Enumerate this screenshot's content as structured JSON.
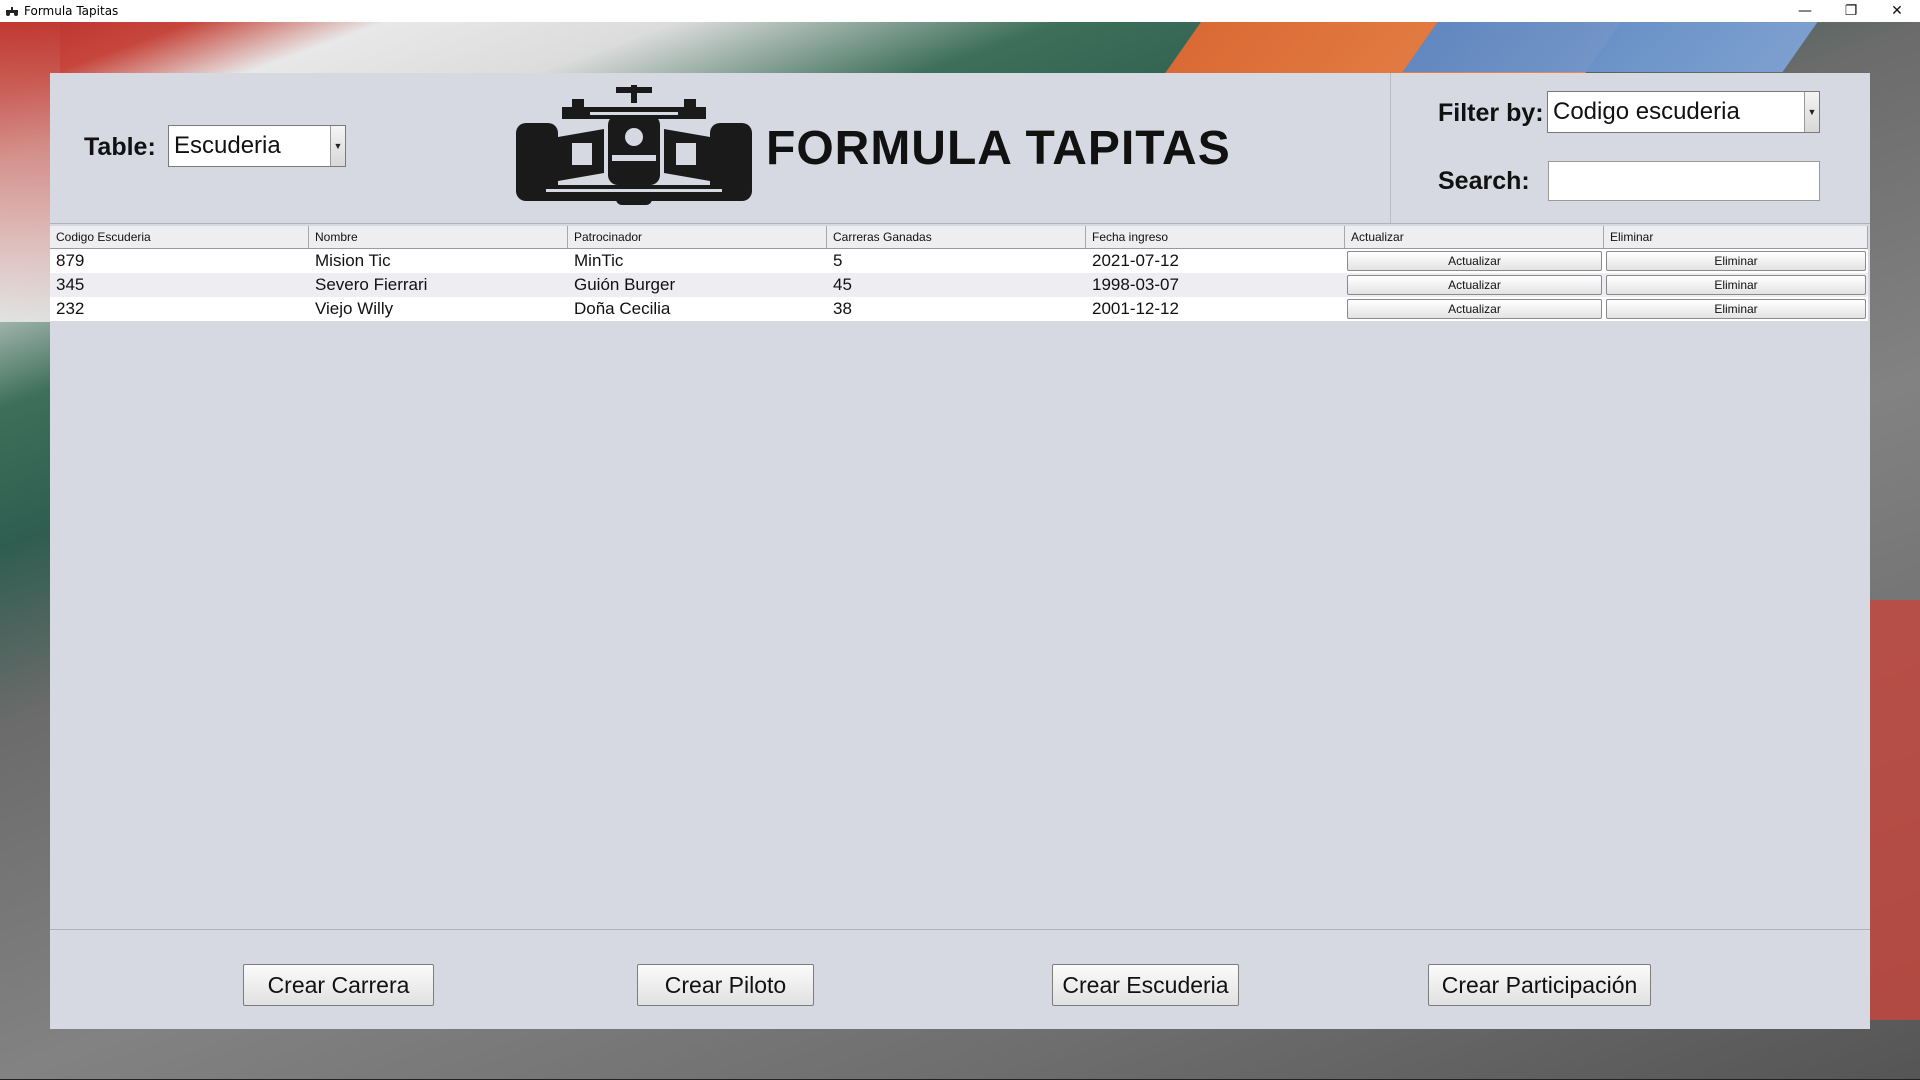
{
  "window": {
    "title": "Formula Tapitas",
    "app_icon": "race-car-icon",
    "controls": [
      "—",
      "❐",
      "✕"
    ]
  },
  "header": {
    "table_label": "Table:",
    "table_value": "Escuderia",
    "logo_text": "FORMULA TAPITAS",
    "logo_icon": "formula-car-icon",
    "filter_label": "Filter by:",
    "filter_value": "Codigo escuderia",
    "search_label": "Search:",
    "search_value": ""
  },
  "table": {
    "columns": [
      "Codigo Escuderia",
      "Nombre",
      "Patrocinador",
      "Carreras Ganadas",
      "Fecha ingreso",
      "Actualizar",
      "Eliminar"
    ],
    "rows": [
      {
        "codigo": "879",
        "nombre": "Mision Tic",
        "patrocinador": "MinTic",
        "carreras": "5",
        "fecha": "2021-07-12",
        "actualizar": "Actualizar",
        "eliminar": "Eliminar"
      },
      {
        "codigo": "345",
        "nombre": "Severo Fierrari",
        "patrocinador": "Guión Burger",
        "carreras": "45",
        "fecha": "1998-03-07",
        "actualizar": "Actualizar",
        "eliminar": "Eliminar"
      },
      {
        "codigo": "232",
        "nombre": "Viejo Willy",
        "patrocinador": "Doña Cecilia",
        "carreras": "38",
        "fecha": "2001-12-12",
        "actualizar": "Actualizar",
        "eliminar": "Eliminar"
      }
    ],
    "row_colors": [
      "#ffffff",
      "#eeeef2",
      "#ffffff"
    ]
  },
  "footer": {
    "buttons": [
      "Crear Carrera",
      "Crear Piloto",
      "Crear Escuderia",
      "Crear Participación"
    ]
  }
}
